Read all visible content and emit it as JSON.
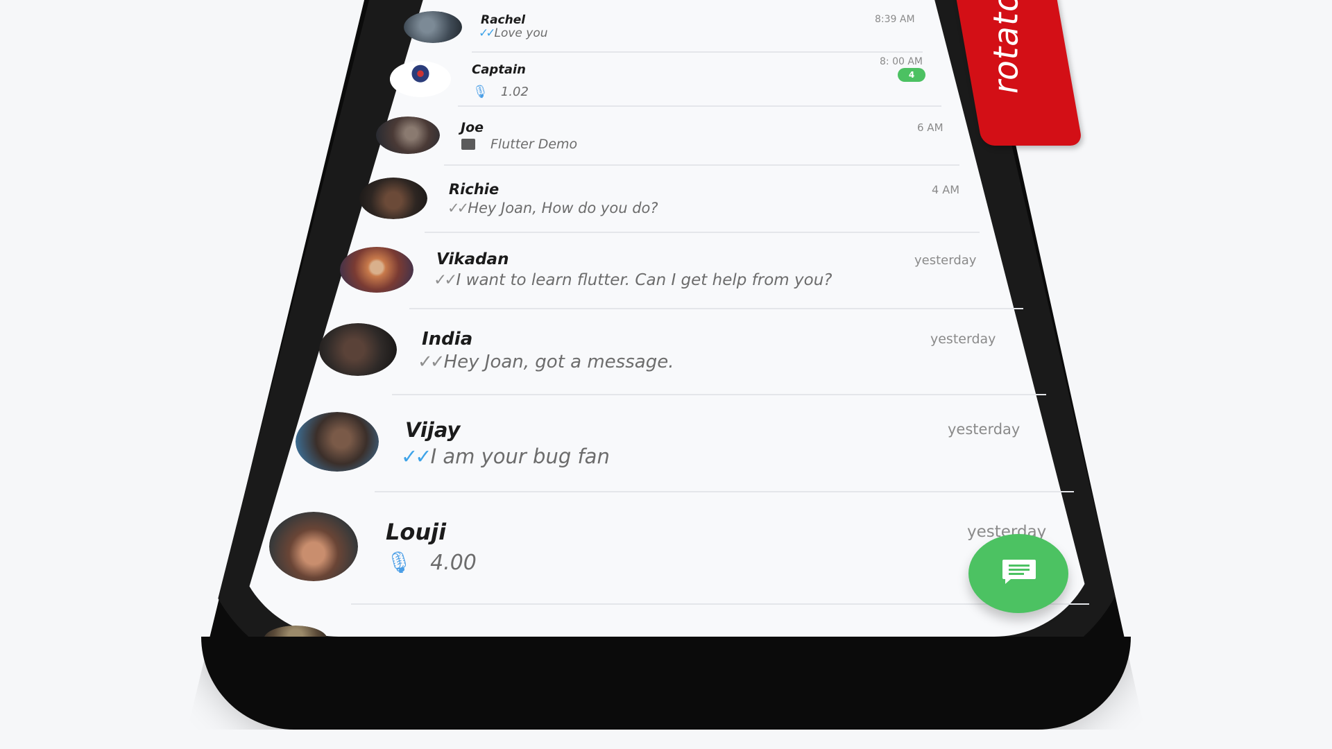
{
  "tag": {
    "text": "rotato.xyz/f"
  },
  "chats": [
    {
      "name": "Rachel",
      "time": "8:39 AM",
      "message": "Love you",
      "kind": "read",
      "tick_color": "#3ea3e8",
      "avatar_color": "#3f4a55"
    },
    {
      "name": "Captain",
      "time": "8: 00 AM",
      "message": "1.02",
      "kind": "audio",
      "badge": "4",
      "avatar_color": "#2b3c7a"
    },
    {
      "name": "Joe",
      "time": "6 AM",
      "message": "Flutter Demo",
      "kind": "document",
      "avatar_color": "#4a3a36"
    },
    {
      "name": "Richie",
      "time": "4 AM",
      "message": "Hey Joan, How do you do?",
      "kind": "read",
      "tick_color": "#8e8e8e",
      "avatar_color": "#2e2622"
    },
    {
      "name": "Vikadan",
      "time": "yesterday",
      "message": "I want to learn flutter. Can I get help from you?",
      "kind": "read",
      "tick_color": "#8e8e8e",
      "avatar_color": "#7a3b33"
    },
    {
      "name": "India",
      "time": "yesterday",
      "message": "Hey Joan, got a message.",
      "kind": "read",
      "tick_color": "#8e8e8e",
      "avatar_color": "#2f2a28"
    },
    {
      "name": "Vijay",
      "time": "yesterday",
      "message": "I am your bug fan",
      "kind": "read",
      "tick_color": "#3ea3e8",
      "avatar_color": "#3b2f2a"
    },
    {
      "name": "Louji",
      "time": "yesterday",
      "message": "4.00",
      "kind": "audio",
      "avatar_color": "#6a4536"
    }
  ],
  "fab": {
    "icon": "message-icon",
    "color": "#4cc262"
  }
}
